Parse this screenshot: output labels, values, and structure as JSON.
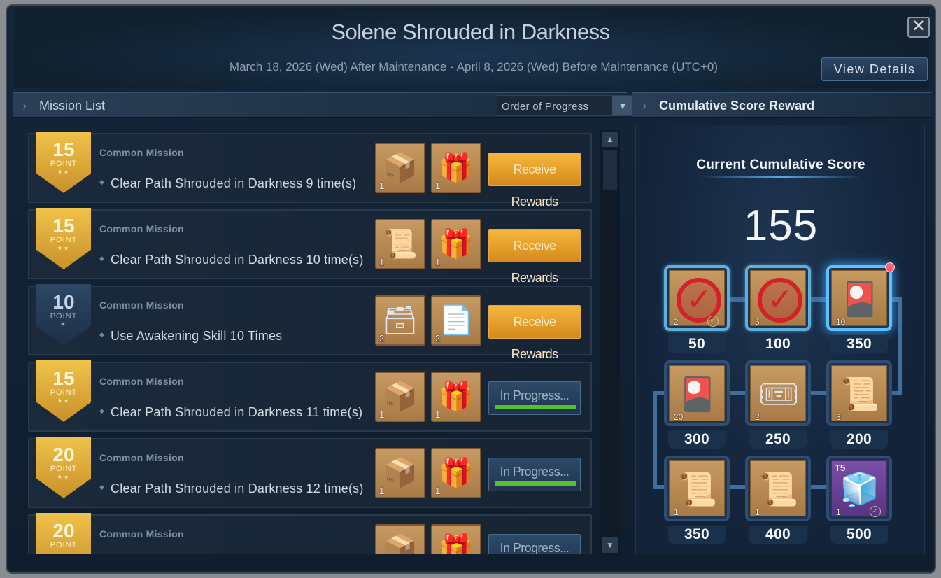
{
  "event": {
    "title": "Solene Shrouded in Darkness",
    "period": "March 18, 2026 (Wed) After Maintenance - April 8, 2026 (Wed) Before Maintenance (UTC+0)",
    "view_details_label": "View Details",
    "close_glyph": "✕"
  },
  "mission_list": {
    "header": "Mission List",
    "sort_value": "Order of Progress",
    "items": [
      {
        "points": "15",
        "point_label": "POINT",
        "type": "Common Mission",
        "description": "Clear Path Shrouded in Darkness 9 time(s)",
        "rewards": [
          {
            "icon": "dark-chest-icon",
            "qty": "1"
          },
          {
            "icon": "gold-chest-icon",
            "qty": "1"
          }
        ],
        "action": "Receive Rewards",
        "status": "receive"
      },
      {
        "points": "15",
        "point_label": "POINT",
        "type": "Common Mission",
        "description": "Clear Path Shrouded in Darkness 10 time(s)",
        "rewards": [
          {
            "icon": "scroll-icon",
            "qty": "1"
          },
          {
            "icon": "gold-chest-icon",
            "qty": "1"
          }
        ],
        "action": "Receive Rewards",
        "status": "receive"
      },
      {
        "points": "10",
        "point_label": "POINT",
        "type": "Common Mission",
        "description": "Use Awakening Skill 10 Times",
        "rewards": [
          {
            "icon": "cube-chest-icon",
            "qty": "2"
          },
          {
            "icon": "blueprint-scroll-icon",
            "qty": "2"
          }
        ],
        "action": "Receive Rewards",
        "status": "receive"
      },
      {
        "points": "15",
        "point_label": "POINT",
        "type": "Common Mission",
        "description": "Clear Path Shrouded in Darkness 11 time(s)",
        "rewards": [
          {
            "icon": "dark-chest-icon",
            "qty": "1"
          },
          {
            "icon": "gold-chest-icon",
            "qty": "1"
          }
        ],
        "action": "In Progress...",
        "status": "progress"
      },
      {
        "points": "20",
        "point_label": "POINT",
        "type": "Common Mission",
        "description": "Clear Path Shrouded in Darkness 12 time(s)",
        "rewards": [
          {
            "icon": "dark-chest-icon",
            "qty": "1"
          },
          {
            "icon": "gold-chest-icon",
            "qty": "1"
          }
        ],
        "action": "In Progress...",
        "status": "progress"
      },
      {
        "points": "20",
        "point_label": "POINT",
        "type": "Common Mission",
        "description": "",
        "rewards": [
          {
            "icon": "dark-chest-icon",
            "qty": ""
          },
          {
            "icon": "gold-chest-icon",
            "qty": ""
          }
        ],
        "action": "In Progress...",
        "status": "progress"
      }
    ]
  },
  "reward_panel": {
    "header": "Cumulative Score Reward",
    "score_label": "Current Cumulative Score",
    "score_value": "155",
    "tiles": [
      {
        "score": "50",
        "qty": "2",
        "icon": "crossed-out-item-icon",
        "state": "claimed"
      },
      {
        "score": "100",
        "qty": "5",
        "icon": "crossed-out-item-icon",
        "state": "claimed"
      },
      {
        "score": "350",
        "qty": "10",
        "icon": "card-pack-icon",
        "state": "available"
      },
      {
        "score": "300",
        "qty": "20",
        "icon": "card-pack-icon",
        "state": "locked"
      },
      {
        "score": "250",
        "qty": "2",
        "icon": "ticket-icon",
        "state": "locked"
      },
      {
        "score": "200",
        "qty": "3",
        "icon": "swap-scroll-icon",
        "state": "locked"
      },
      {
        "score": "350",
        "qty": "1",
        "icon": "upgrade-scroll-icon",
        "state": "locked"
      },
      {
        "score": "400",
        "qty": "1",
        "icon": "scroll-icon",
        "state": "locked"
      },
      {
        "score": "500",
        "qty": "1",
        "icon": "t5-cube-icon",
        "state": "locked",
        "tier": "T5"
      }
    ]
  },
  "colors": {
    "gold_badge": "#e0a83a",
    "receive_button": "#e9a02c",
    "progress_fill": "#58c02c",
    "active_glow": "#3fa8ff"
  }
}
